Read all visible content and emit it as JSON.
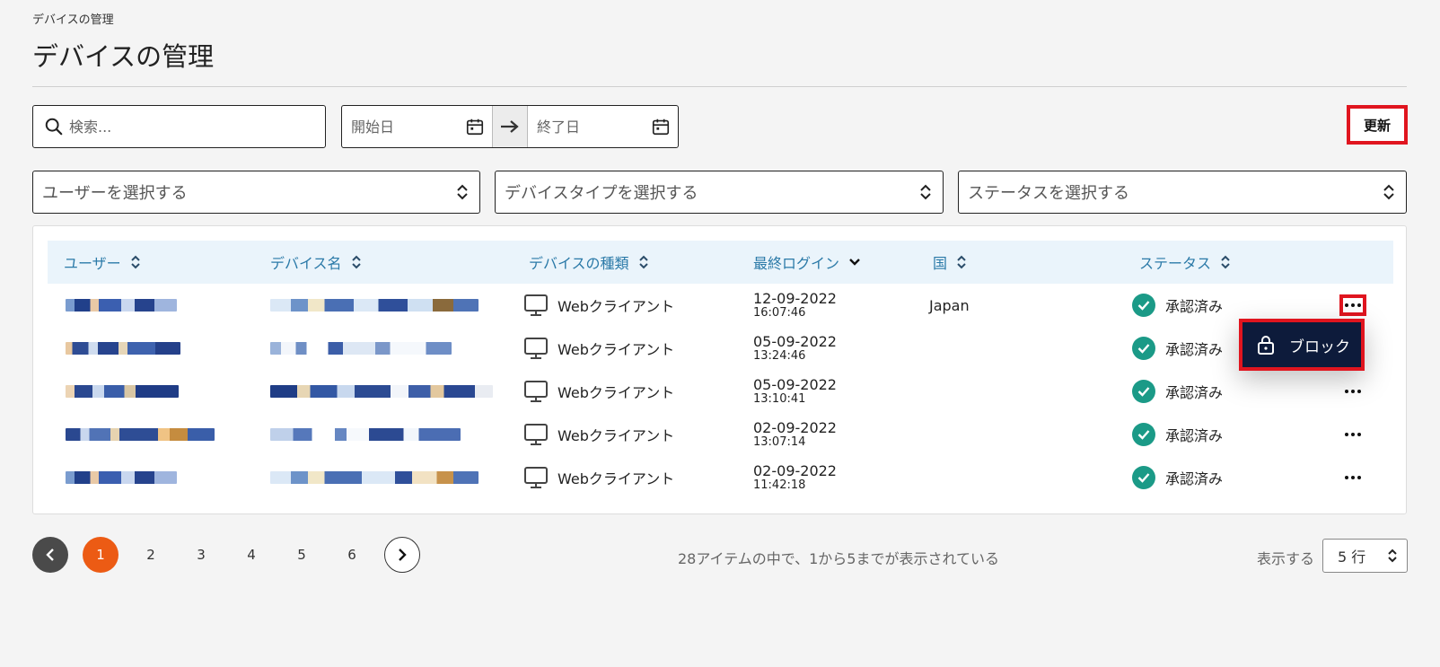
{
  "breadcrumb": "デバイスの管理",
  "page_title": "デバイスの管理",
  "toolbar": {
    "search_placeholder": "検索...",
    "start_placeholder": "開始日",
    "end_placeholder": "終了日",
    "refresh_label": "更新"
  },
  "filters": {
    "user": "ユーザーを選択する",
    "device_type": "デバイスタイプを選択する",
    "status": "ステータスを選択する"
  },
  "table": {
    "headers": {
      "user": "ユーザー",
      "device_name": "デバイス名",
      "device_type": "デバイスの種類",
      "last_login": "最終ログイン",
      "country": "国",
      "status": "ステータス"
    },
    "rows": [
      {
        "device_type": "Webクライアント",
        "date": "12-09-2022",
        "time": "16:07:46",
        "country": "Japan",
        "status": "承認済み"
      },
      {
        "device_type": "Webクライアント",
        "date": "05-09-2022",
        "time": "13:24:46",
        "country": "",
        "status": "承認済み"
      },
      {
        "device_type": "Webクライアント",
        "date": "05-09-2022",
        "time": "13:10:41",
        "country": "",
        "status": "承認済み"
      },
      {
        "device_type": "Webクライアント",
        "date": "02-09-2022",
        "time": "13:07:14",
        "country": "",
        "status": "承認済み"
      },
      {
        "device_type": "Webクライアント",
        "date": "02-09-2022",
        "time": "11:42:18",
        "country": "",
        "status": "承認済み"
      }
    ]
  },
  "row_menu": {
    "block_label": "ブロック"
  },
  "pagination": {
    "pages": [
      "1",
      "2",
      "3",
      "4",
      "5",
      "6"
    ],
    "current": "1",
    "summary": "28アイテムの中で、1から5までが表示されている",
    "show_label": "表示する",
    "rows_per_page": "5 行"
  },
  "colors": {
    "accent_header": "#2b7aa8",
    "status_ok": "#1b9a87",
    "page_active": "#ec5b14",
    "highlight": "#e0151f",
    "menu_bg": "#0d1b3b"
  }
}
